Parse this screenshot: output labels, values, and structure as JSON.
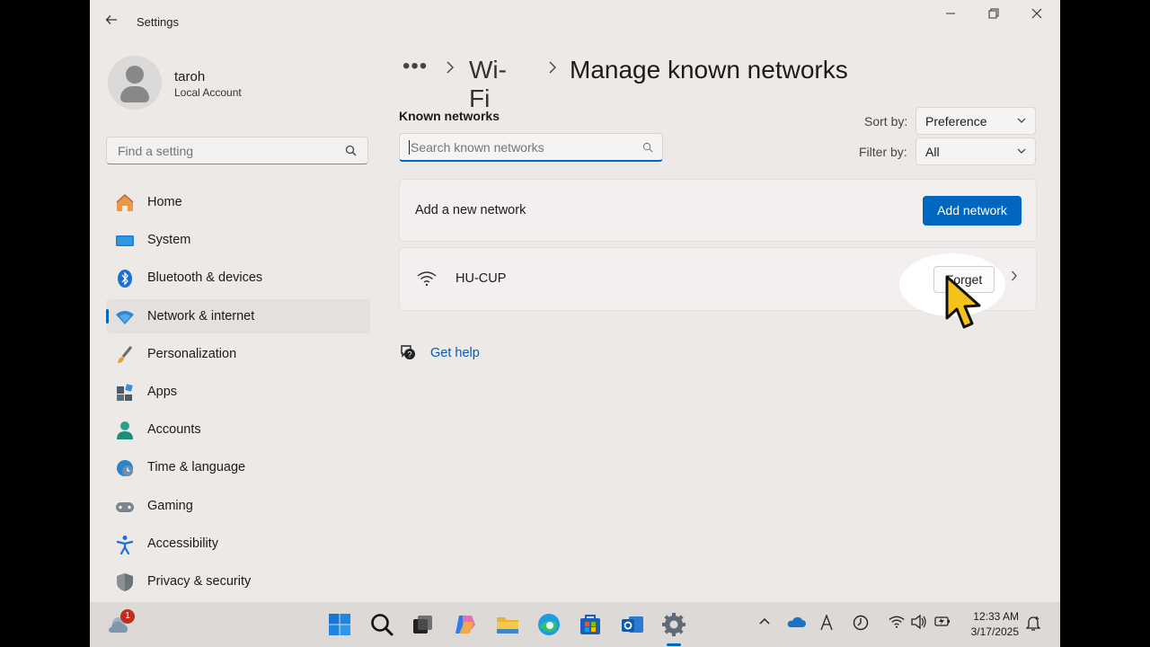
{
  "window": {
    "title": "Settings",
    "back_icon": "back-arrow-icon"
  },
  "user": {
    "name": "taroh",
    "account_type": "Local Account"
  },
  "sidebar": {
    "search_placeholder": "Find a setting",
    "items": [
      {
        "label": "Home",
        "icon": "home-icon",
        "active": false
      },
      {
        "label": "System",
        "icon": "system-icon",
        "active": false
      },
      {
        "label": "Bluetooth & devices",
        "icon": "bluetooth-icon",
        "active": false
      },
      {
        "label": "Network & internet",
        "icon": "network-icon",
        "active": true
      },
      {
        "label": "Personalization",
        "icon": "brush-icon",
        "active": false
      },
      {
        "label": "Apps",
        "icon": "apps-icon",
        "active": false
      },
      {
        "label": "Accounts",
        "icon": "accounts-icon",
        "active": false
      },
      {
        "label": "Time & language",
        "icon": "time-language-icon",
        "active": false
      },
      {
        "label": "Gaming",
        "icon": "gaming-icon",
        "active": false
      },
      {
        "label": "Accessibility",
        "icon": "accessibility-icon",
        "active": false
      },
      {
        "label": "Privacy & security",
        "icon": "shield-icon",
        "active": false
      }
    ]
  },
  "breadcrumb": {
    "more": "•••",
    "parent": "Wi-Fi",
    "current": "Manage known networks"
  },
  "known_networks": {
    "heading": "Known networks",
    "search_placeholder": "Search known networks",
    "sort_label": "Sort by:",
    "sort_value": "Preference",
    "filter_label": "Filter by:",
    "filter_value": "All"
  },
  "add_network": {
    "label": "Add a new network",
    "button": "Add network"
  },
  "networks": [
    {
      "name": "HU-CUP",
      "forget_button": "Forget"
    }
  ],
  "help": {
    "label": "Get help"
  },
  "taskbar": {
    "notification_count": "1",
    "time": "12:33 AM",
    "date": "3/17/2025"
  },
  "colors": {
    "accent": "#0067c0",
    "window_bg": "#ece9e7",
    "taskbar_bg": "#dcd9d6"
  }
}
